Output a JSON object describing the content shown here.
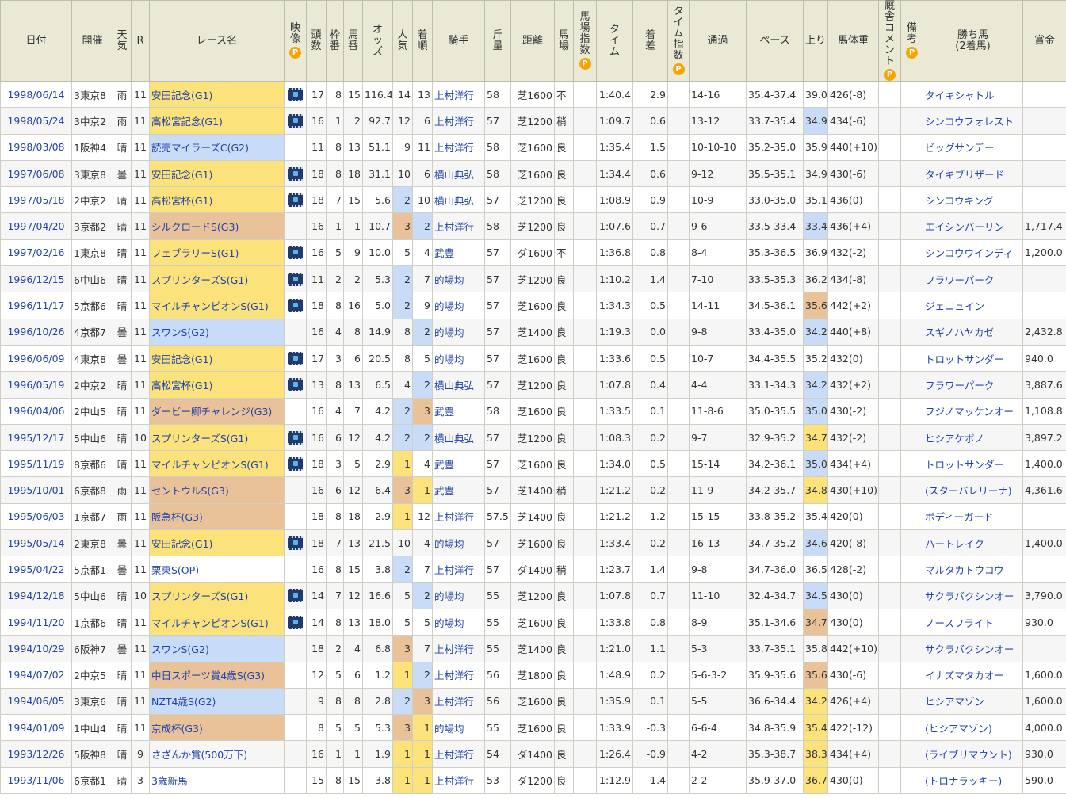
{
  "headers": {
    "date": "日付",
    "venue": "開催",
    "weather": "天気",
    "race_no": "R",
    "race_name": "レース名",
    "video": "映像",
    "heads": "頭数",
    "frame": "枠番",
    "horse_no": "馬番",
    "odds": "オッズ",
    "pop": "人気",
    "finish": "着順",
    "jockey": "騎手",
    "weight": "斤量",
    "distance": "距離",
    "going": "馬場",
    "track_index": "馬場指数",
    "time": "タイム",
    "margin": "着差",
    "time_index": "タイム指数",
    "passing": "通過",
    "pace": "ペース",
    "last3f": "上り",
    "body_weight": "馬体重",
    "comment": "厩舎コメント",
    "remarks": "備考",
    "winner": "勝ち馬",
    "winner_sub": "(2着馬)",
    "prize": "賞金",
    "p_badge": "P"
  },
  "colors": {
    "header_bg": "#e9e9d6",
    "g1": "#fbe27a",
    "g2": "#c9dcf7",
    "g3": "#e9c29a",
    "link": "#2244aa",
    "p_badge": "#f5a400"
  },
  "rows": [
    {
      "date": "1998/06/14",
      "venue": "3東京8",
      "weather": "雨",
      "r": "11",
      "race": "安田記念(G1)",
      "grade": "g1",
      "video": true,
      "heads": "17",
      "frame": "8",
      "no": "15",
      "odds": "116.4",
      "pop": "14",
      "pc": "",
      "fin": "13",
      "fc": "",
      "jockey": "上村洋行",
      "jl": true,
      "wt": "58",
      "dist": "芝1600",
      "going": "不",
      "time": "1:40.4",
      "margin": "2.9",
      "pass": "14-16",
      "pace": "35.4-37.4",
      "up": "39.0",
      "uc": "",
      "bw": "426(-8)",
      "winner": "タイキシャトル",
      "prize": ""
    },
    {
      "date": "1998/05/24",
      "venue": "3中京2",
      "weather": "雨",
      "r": "11",
      "race": "高松宮記念(G1)",
      "grade": "g1",
      "video": true,
      "heads": "16",
      "frame": "1",
      "no": "2",
      "odds": "92.7",
      "pop": "12",
      "pc": "",
      "fin": "6",
      "fc": "",
      "jockey": "上村洋行",
      "jl": true,
      "wt": "57",
      "dist": "芝1200",
      "going": "稍",
      "time": "1:09.7",
      "margin": "0.6",
      "pass": "13-12",
      "pace": "33.7-35.4",
      "up": "34.9",
      "uc": "u1",
      "bw": "434(-6)",
      "winner": "シンコウフォレスト",
      "prize": ""
    },
    {
      "date": "1998/03/08",
      "venue": "1阪神4",
      "weather": "晴",
      "r": "11",
      "race": "読売マイラーズC(G2)",
      "grade": "g2",
      "video": false,
      "heads": "11",
      "frame": "8",
      "no": "13",
      "odds": "51.1",
      "pop": "9",
      "pc": "",
      "fin": "11",
      "fc": "",
      "jockey": "上村洋行",
      "jl": true,
      "wt": "58",
      "dist": "芝1600",
      "going": "良",
      "time": "1:35.4",
      "margin": "1.5",
      "pass": "10-10-10",
      "pace": "35.2-35.0",
      "up": "35.9",
      "uc": "",
      "bw": "440(+10)",
      "winner": "ビッグサンデー",
      "prize": ""
    },
    {
      "date": "1997/06/08",
      "venue": "3東京8",
      "weather": "曇",
      "r": "11",
      "race": "安田記念(G1)",
      "grade": "g1",
      "video": true,
      "heads": "18",
      "frame": "8",
      "no": "18",
      "odds": "31.1",
      "pop": "10",
      "pc": "",
      "fin": "6",
      "fc": "",
      "jockey": "横山典弘",
      "jl": true,
      "wt": "58",
      "dist": "芝1600",
      "going": "良",
      "time": "1:34.4",
      "margin": "0.6",
      "pass": "9-12",
      "pace": "35.5-35.1",
      "up": "34.9",
      "uc": "",
      "bw": "430(-6)",
      "winner": "タイキブリザード",
      "prize": ""
    },
    {
      "date": "1997/05/18",
      "venue": "2中京2",
      "weather": "晴",
      "r": "11",
      "race": "高松宮杯(G1)",
      "grade": "g1",
      "video": true,
      "heads": "18",
      "frame": "7",
      "no": "15",
      "odds": "5.6",
      "pop": "2",
      "pc": "p2",
      "fin": "10",
      "fc": "",
      "jockey": "横山典弘",
      "jl": true,
      "wt": "57",
      "dist": "芝1200",
      "going": "良",
      "time": "1:08.9",
      "margin": "0.9",
      "pass": "10-9",
      "pace": "33.0-35.0",
      "up": "35.1",
      "uc": "",
      "bw": "436(0)",
      "winner": "シンコウキング",
      "prize": ""
    },
    {
      "date": "1997/04/20",
      "venue": "3京都2",
      "weather": "晴",
      "r": "11",
      "race": "シルクロードS(G3)",
      "grade": "g3",
      "video": false,
      "heads": "16",
      "frame": "1",
      "no": "1",
      "odds": "10.7",
      "pop": "3",
      "pc": "p3",
      "fin": "2",
      "fc": "p2",
      "jockey": "上村洋行",
      "jl": true,
      "wt": "58",
      "dist": "芝1200",
      "going": "良",
      "time": "1:07.6",
      "margin": "0.7",
      "pass": "9-6",
      "pace": "33.5-33.4",
      "up": "33.4",
      "uc": "u1",
      "bw": "436(+4)",
      "winner": "エイシンバーリン",
      "prize": "1,717.4"
    },
    {
      "date": "1997/02/16",
      "venue": "1東京8",
      "weather": "晴",
      "r": "11",
      "race": "フェブラリーS(G1)",
      "grade": "g1",
      "video": true,
      "heads": "16",
      "frame": "5",
      "no": "9",
      "odds": "10.0",
      "pop": "5",
      "pc": "",
      "fin": "4",
      "fc": "",
      "jockey": "武豊",
      "jl": true,
      "wt": "57",
      "dist": "ダ1600",
      "going": "不",
      "time": "1:36.8",
      "margin": "0.8",
      "pass": "8-4",
      "pace": "35.3-36.5",
      "up": "36.9",
      "uc": "",
      "bw": "432(-2)",
      "winner": "シンコウウインディ",
      "prize": "1,200.0"
    },
    {
      "date": "1996/12/15",
      "venue": "6中山6",
      "weather": "晴",
      "r": "11",
      "race": "スプリンターズS(G1)",
      "grade": "g1",
      "video": true,
      "heads": "11",
      "frame": "2",
      "no": "2",
      "odds": "5.3",
      "pop": "2",
      "pc": "p2",
      "fin": "7",
      "fc": "",
      "jockey": "的場均",
      "jl": true,
      "wt": "57",
      "dist": "芝1200",
      "going": "良",
      "time": "1:10.2",
      "margin": "1.4",
      "pass": "7-10",
      "pace": "33.5-35.3",
      "up": "36.2",
      "uc": "",
      "bw": "434(-8)",
      "winner": "フラワーパーク",
      "prize": ""
    },
    {
      "date": "1996/11/17",
      "venue": "5京都6",
      "weather": "晴",
      "r": "11",
      "race": "マイルチャンピオンS(G1)",
      "grade": "g1",
      "video": true,
      "heads": "18",
      "frame": "8",
      "no": "16",
      "odds": "5.0",
      "pop": "2",
      "pc": "p2",
      "fin": "9",
      "fc": "",
      "jockey": "的場均",
      "jl": true,
      "wt": "57",
      "dist": "芝1600",
      "going": "良",
      "time": "1:34.3",
      "margin": "0.5",
      "pass": "14-11",
      "pace": "34.5-36.1",
      "up": "35.6",
      "uc": "u3",
      "bw": "442(+2)",
      "winner": "ジェニュイン",
      "prize": ""
    },
    {
      "date": "1996/10/26",
      "venue": "4京都7",
      "weather": "曇",
      "r": "11",
      "race": "スワンS(G2)",
      "grade": "g2",
      "video": false,
      "heads": "16",
      "frame": "4",
      "no": "8",
      "odds": "14.9",
      "pop": "8",
      "pc": "",
      "fin": "2",
      "fc": "p2",
      "jockey": "的場均",
      "jl": true,
      "wt": "57",
      "dist": "芝1400",
      "going": "良",
      "time": "1:19.3",
      "margin": "0.0",
      "pass": "9-8",
      "pace": "33.4-35.0",
      "up": "34.2",
      "uc": "u1",
      "bw": "440(+8)",
      "winner": "スギノハヤカゼ",
      "prize": "2,432.8"
    },
    {
      "date": "1996/06/09",
      "venue": "4東京8",
      "weather": "曇",
      "r": "11",
      "race": "安田記念(G1)",
      "grade": "g1",
      "video": true,
      "heads": "17",
      "frame": "3",
      "no": "6",
      "odds": "20.5",
      "pop": "8",
      "pc": "",
      "fin": "5",
      "fc": "",
      "jockey": "的場均",
      "jl": true,
      "wt": "57",
      "dist": "芝1600",
      "going": "良",
      "time": "1:33.6",
      "margin": "0.5",
      "pass": "10-7",
      "pace": "34.4-35.5",
      "up": "35.2",
      "uc": "",
      "bw": "432(0)",
      "winner": "トロットサンダー",
      "prize": "940.0"
    },
    {
      "date": "1996/05/19",
      "venue": "2中京2",
      "weather": "晴",
      "r": "11",
      "race": "高松宮杯(G1)",
      "grade": "g1",
      "video": true,
      "heads": "13",
      "frame": "8",
      "no": "13",
      "odds": "6.5",
      "pop": "4",
      "pc": "",
      "fin": "2",
      "fc": "p2",
      "jockey": "横山典弘",
      "jl": true,
      "wt": "57",
      "dist": "芝1200",
      "going": "良",
      "time": "1:07.8",
      "margin": "0.4",
      "pass": "4-4",
      "pace": "33.1-34.3",
      "up": "34.2",
      "uc": "u1",
      "bw": "432(+2)",
      "winner": "フラワーパーク",
      "prize": "3,887.6"
    },
    {
      "date": "1996/04/06",
      "venue": "2中山5",
      "weather": "晴",
      "r": "11",
      "race": "ダービー卿チャレンジ(G3)",
      "grade": "g3",
      "video": false,
      "heads": "16",
      "frame": "4",
      "no": "7",
      "odds": "4.2",
      "pop": "2",
      "pc": "p2",
      "fin": "3",
      "fc": "p3",
      "jockey": "武豊",
      "jl": true,
      "wt": "58",
      "dist": "芝1600",
      "going": "良",
      "time": "1:33.5",
      "margin": "0.1",
      "pass": "11-8-6",
      "pace": "35.0-35.5",
      "up": "35.0",
      "uc": "u1",
      "bw": "430(-2)",
      "winner": "フジノマッケンオー",
      "prize": "1,108.8"
    },
    {
      "date": "1995/12/17",
      "venue": "5中山6",
      "weather": "晴",
      "r": "10",
      "race": "スプリンターズS(G1)",
      "grade": "g1",
      "video": true,
      "heads": "16",
      "frame": "6",
      "no": "12",
      "odds": "4.2",
      "pop": "2",
      "pc": "p2",
      "fin": "2",
      "fc": "p2",
      "jockey": "横山典弘",
      "jl": true,
      "wt": "57",
      "dist": "芝1200",
      "going": "良",
      "time": "1:08.3",
      "margin": "0.2",
      "pass": "9-7",
      "pace": "32.9-35.2",
      "up": "34.7",
      "uc": "u2",
      "bw": "432(-2)",
      "winner": "ヒシアケボノ",
      "prize": "3,897.2"
    },
    {
      "date": "1995/11/19",
      "venue": "8京都6",
      "weather": "晴",
      "r": "11",
      "race": "マイルチャンピオンS(G1)",
      "grade": "g1",
      "video": true,
      "heads": "18",
      "frame": "3",
      "no": "5",
      "odds": "2.9",
      "pop": "1",
      "pc": "p1",
      "fin": "4",
      "fc": "",
      "jockey": "武豊",
      "jl": true,
      "wt": "57",
      "dist": "芝1600",
      "going": "良",
      "time": "1:34.0",
      "margin": "0.5",
      "pass": "15-14",
      "pace": "34.2-36.1",
      "up": "35.0",
      "uc": "u1",
      "bw": "434(+4)",
      "winner": "トロットサンダー",
      "prize": "1,400.0"
    },
    {
      "date": "1995/10/01",
      "venue": "6京都8",
      "weather": "雨",
      "r": "11",
      "race": "セントウルS(G3)",
      "grade": "g3",
      "video": false,
      "heads": "16",
      "frame": "6",
      "no": "12",
      "odds": "6.4",
      "pop": "3",
      "pc": "p3",
      "fin": "1",
      "fc": "p1",
      "jockey": "武豊",
      "jl": true,
      "wt": "57",
      "dist": "芝1400",
      "going": "稍",
      "time": "1:21.2",
      "margin": "-0.2",
      "pass": "11-9",
      "pace": "34.2-35.7",
      "up": "34.8",
      "uc": "u2",
      "bw": "430(+10)",
      "winner": "(スターバレリーナ)",
      "prize": "4,361.6"
    },
    {
      "date": "1995/06/03",
      "venue": "1京都7",
      "weather": "雨",
      "r": "11",
      "race": "阪急杯(G3)",
      "grade": "g3",
      "video": false,
      "heads": "18",
      "frame": "8",
      "no": "18",
      "odds": "2.9",
      "pop": "1",
      "pc": "p1",
      "fin": "12",
      "fc": "",
      "jockey": "上村洋行",
      "jl": true,
      "wt": "57.5",
      "dist": "芝1400",
      "going": "良",
      "time": "1:21.2",
      "margin": "1.2",
      "pass": "15-15",
      "pace": "33.8-35.2",
      "up": "35.4",
      "uc": "",
      "bw": "420(0)",
      "winner": "ボディーガード",
      "prize": ""
    },
    {
      "date": "1995/05/14",
      "venue": "2東京8",
      "weather": "曇",
      "r": "11",
      "race": "安田記念(G1)",
      "grade": "g1",
      "video": true,
      "heads": "18",
      "frame": "7",
      "no": "13",
      "odds": "21.5",
      "pop": "10",
      "pc": "",
      "fin": "4",
      "fc": "",
      "jockey": "的場均",
      "jl": true,
      "wt": "57",
      "dist": "芝1600",
      "going": "良",
      "time": "1:33.4",
      "margin": "0.2",
      "pass": "16-13",
      "pace": "34.7-35.2",
      "up": "34.6",
      "uc": "u1",
      "bw": "420(-8)",
      "winner": "ハートレイク",
      "prize": "1,400.0"
    },
    {
      "date": "1995/04/22",
      "venue": "5京都1",
      "weather": "曇",
      "r": "11",
      "race": "栗東S(OP)",
      "grade": "",
      "video": false,
      "heads": "16",
      "frame": "8",
      "no": "15",
      "odds": "3.8",
      "pop": "2",
      "pc": "p2",
      "fin": "7",
      "fc": "",
      "jockey": "上村洋行",
      "jl": true,
      "wt": "57",
      "dist": "ダ1400",
      "going": "稍",
      "time": "1:23.7",
      "margin": "1.4",
      "pass": "9-8",
      "pace": "34.7-36.0",
      "up": "36.5",
      "uc": "",
      "bw": "428(-2)",
      "winner": "マルタカトウコウ",
      "prize": ""
    },
    {
      "date": "1994/12/18",
      "venue": "5中山6",
      "weather": "晴",
      "r": "10",
      "race": "スプリンターズS(G1)",
      "grade": "g1",
      "video": true,
      "heads": "14",
      "frame": "7",
      "no": "12",
      "odds": "16.6",
      "pop": "5",
      "pc": "",
      "fin": "2",
      "fc": "p2",
      "jockey": "的場均",
      "jl": true,
      "wt": "55",
      "dist": "芝1200",
      "going": "良",
      "time": "1:07.8",
      "margin": "0.7",
      "pass": "11-10",
      "pace": "32.4-34.7",
      "up": "34.5",
      "uc": "u1",
      "bw": "430(0)",
      "winner": "サクラバクシンオー",
      "prize": "3,790.0"
    },
    {
      "date": "1994/11/20",
      "venue": "1京都6",
      "weather": "晴",
      "r": "11",
      "race": "マイルチャンピオンS(G1)",
      "grade": "g1",
      "video": true,
      "heads": "14",
      "frame": "8",
      "no": "13",
      "odds": "18.0",
      "pop": "5",
      "pc": "",
      "fin": "5",
      "fc": "",
      "jockey": "的場均",
      "jl": true,
      "wt": "55",
      "dist": "芝1600",
      "going": "良",
      "time": "1:33.8",
      "margin": "0.8",
      "pass": "8-9",
      "pace": "35.1-34.6",
      "up": "34.7",
      "uc": "u3",
      "bw": "430(0)",
      "winner": "ノースフライト",
      "prize": "930.0"
    },
    {
      "date": "1994/10/29",
      "venue": "6阪神7",
      "weather": "曇",
      "r": "11",
      "race": "スワンS(G2)",
      "grade": "g2",
      "video": false,
      "heads": "18",
      "frame": "2",
      "no": "4",
      "odds": "6.8",
      "pop": "3",
      "pc": "p3",
      "fin": "7",
      "fc": "",
      "jockey": "上村洋行",
      "jl": true,
      "wt": "55",
      "dist": "芝1400",
      "going": "良",
      "time": "1:21.0",
      "margin": "1.1",
      "pass": "5-3",
      "pace": "33.7-35.1",
      "up": "35.8",
      "uc": "",
      "bw": "442(+10)",
      "winner": "サクラバクシンオー",
      "prize": ""
    },
    {
      "date": "1994/07/02",
      "venue": "2中京5",
      "weather": "晴",
      "r": "11",
      "race": "中日スポーツ賞4歳S(G3)",
      "grade": "g3",
      "video": false,
      "heads": "12",
      "frame": "5",
      "no": "6",
      "odds": "1.2",
      "pop": "1",
      "pc": "p1",
      "fin": "2",
      "fc": "p2",
      "jockey": "上村洋行",
      "jl": true,
      "wt": "56",
      "dist": "芝1800",
      "going": "良",
      "time": "1:48.9",
      "margin": "0.2",
      "pass": "5-6-3-2",
      "pace": "35.9-35.6",
      "up": "35.6",
      "uc": "u3",
      "bw": "430(-6)",
      "winner": "イナズマタカオー",
      "prize": "1,600.0"
    },
    {
      "date": "1994/06/05",
      "venue": "3東京6",
      "weather": "晴",
      "r": "11",
      "race": "NZT4歳S(G2)",
      "grade": "g2",
      "video": false,
      "heads": "9",
      "frame": "8",
      "no": "8",
      "odds": "2.8",
      "pop": "2",
      "pc": "p2",
      "fin": "3",
      "fc": "p3",
      "jockey": "上村洋行",
      "jl": true,
      "wt": "56",
      "dist": "芝1600",
      "going": "良",
      "time": "1:35.9",
      "margin": "0.1",
      "pass": "5-5",
      "pace": "36.6-34.4",
      "up": "34.2",
      "uc": "u2",
      "bw": "426(+4)",
      "winner": "ヒシアマゾン",
      "prize": "1,600.0"
    },
    {
      "date": "1994/01/09",
      "venue": "1中山4",
      "weather": "晴",
      "r": "11",
      "race": "京成杯(G3)",
      "grade": "g3",
      "video": false,
      "heads": "8",
      "frame": "5",
      "no": "5",
      "odds": "5.3",
      "pop": "3",
      "pc": "p3",
      "fin": "1",
      "fc": "p1",
      "jockey": "的場均",
      "jl": true,
      "wt": "55",
      "dist": "芝1600",
      "going": "良",
      "time": "1:33.9",
      "margin": "-0.3",
      "pass": "6-6-4",
      "pace": "34.8-35.9",
      "up": "35.4",
      "uc": "u2",
      "bw": "422(-12)",
      "winner": "(ヒシアマゾン)",
      "prize": "4,000.0"
    },
    {
      "date": "1993/12/26",
      "venue": "5阪神8",
      "weather": "晴",
      "r": "9",
      "race": "さざんか賞(500万下)",
      "grade": "",
      "video": false,
      "heads": "16",
      "frame": "1",
      "no": "1",
      "odds": "1.9",
      "pop": "1",
      "pc": "p1",
      "fin": "1",
      "fc": "p1",
      "jockey": "上村洋行",
      "jl": true,
      "wt": "54",
      "dist": "ダ1400",
      "going": "良",
      "time": "1:26.4",
      "margin": "-0.9",
      "pass": "4-2",
      "pace": "35.3-38.7",
      "up": "38.3",
      "uc": "u2",
      "bw": "434(+4)",
      "winner": "(ライブリマウント)",
      "prize": "930.0"
    },
    {
      "date": "1993/11/06",
      "venue": "6京都1",
      "weather": "晴",
      "r": "3",
      "race": "3歳新馬",
      "grade": "",
      "video": false,
      "heads": "15",
      "frame": "8",
      "no": "15",
      "odds": "3.8",
      "pop": "1",
      "pc": "p1",
      "fin": "1",
      "fc": "p1",
      "jockey": "上村洋行",
      "jl": true,
      "wt": "53",
      "dist": "ダ1200",
      "going": "良",
      "time": "1:12.9",
      "margin": "-1.4",
      "pass": "2-2",
      "pace": "35.9-37.0",
      "up": "36.7",
      "uc": "u2",
      "bw": "430(0)",
      "winner": "(トロナラッキー)",
      "prize": "590.0"
    }
  ]
}
